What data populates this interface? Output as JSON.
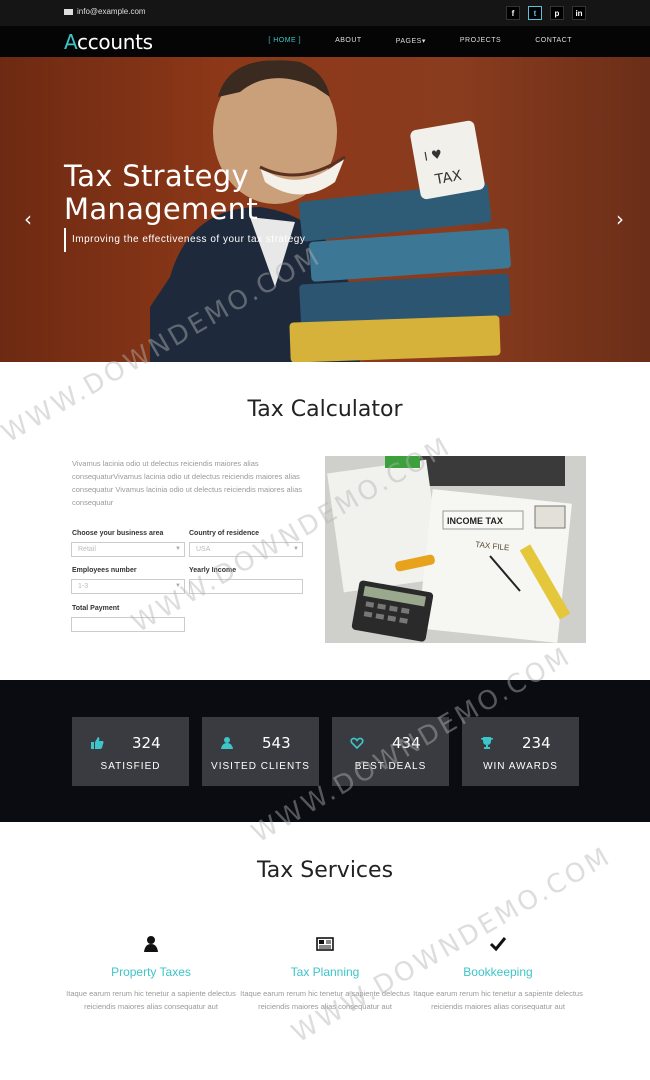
{
  "topbar": {
    "email": "info@example.com",
    "social": [
      {
        "icon": "facebook-icon",
        "glyph": "f"
      },
      {
        "icon": "twitter-icon",
        "glyph": "t"
      },
      {
        "icon": "pinterest-icon",
        "glyph": "p"
      },
      {
        "icon": "linkedin-icon",
        "glyph": "in"
      }
    ]
  },
  "nav": {
    "logo_first": "A",
    "logo_rest": "ccounts",
    "items": [
      "[ HOME ]",
      "ABOUT",
      "PAGES▾",
      "PROJECTS",
      "CONTACT"
    ]
  },
  "hero": {
    "title": "Tax Strategy Management",
    "tagline": "Improving the effectiveness of your tax strategy",
    "prev": "‹",
    "next": "›"
  },
  "calculator": {
    "title": "Tax Calculator",
    "text": "Vivamus lacinia odio ut delectus reiciendis maiores alias consequaturVivamus lacinia odio ut delectus reiciendis maiores alias consequatur Vivamus lacinia odio ut delectus reiciendis maiores alias consequatur",
    "business_label": "Choose your business area",
    "business_value": "Retail",
    "country_label": "Country of residence",
    "country_value": "USA",
    "employees_label": "Employees number",
    "employees_value": "1-3",
    "income_label": "Yearly Income",
    "income_value": "",
    "total_label": "Total Payment",
    "total_value": "",
    "photo_words": [
      "INCOME TAX",
      "TAX FILE"
    ]
  },
  "stats": [
    {
      "icon": "thumbs-up-icon",
      "number": "324",
      "label": "SATISFIED"
    },
    {
      "icon": "user-icon",
      "number": "543",
      "label": "VISITED CLIENTS"
    },
    {
      "icon": "heart-icon",
      "number": "434",
      "label": "BEST DEALS"
    },
    {
      "icon": "trophy-icon",
      "number": "234",
      "label": "WIN AWARDS"
    }
  ],
  "services": {
    "title": "Tax Services",
    "items": [
      {
        "icon": "user-icon",
        "title": "Property Taxes",
        "desc": "Itaque earum rerum hic tenetur a sapiente delectus reiciendis maiores alias consequatur aut"
      },
      {
        "icon": "newspaper-icon",
        "title": "Tax Planning",
        "desc": "Itaque earum rerum hic tenetur a sapiente delectus reiciendis maiores alias consequatur aut"
      },
      {
        "icon": "checkmark-icon",
        "title": "Bookkeeping",
        "desc": "Itaque earum rerum hic tenetur a sapiente delectus reiciendis maiores alias consequatur aut"
      }
    ]
  },
  "watermark": "WWW.DOWNDEMO.COM",
  "colors": {
    "accent": "#3dc5c9",
    "hero": "#8d3818",
    "dark": "#0a0c12",
    "stat_box": "#393b40"
  }
}
